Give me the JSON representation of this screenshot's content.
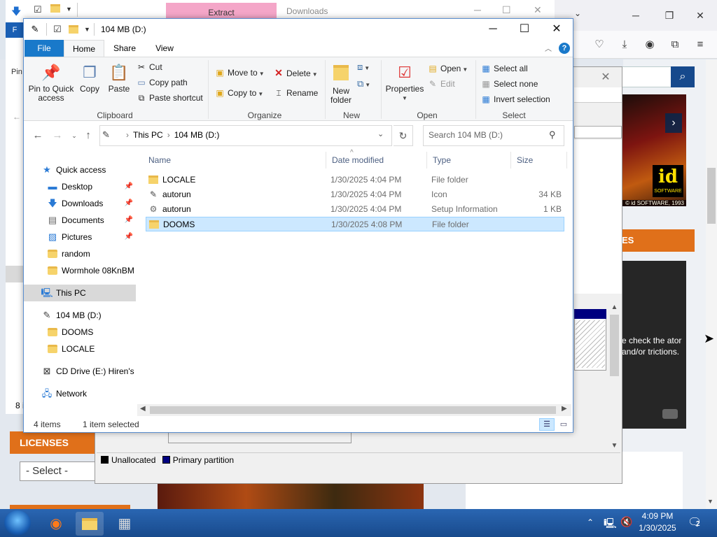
{
  "browser": {
    "controls": [
      "─",
      "❐",
      "✕"
    ],
    "toolbar_icons": [
      "pocket-icon",
      "download-icon",
      "account-icon",
      "extensions-icon",
      "menu-icon"
    ],
    "website": {
      "cover_next": "›",
      "id_logo": "id",
      "id_software": "SOFTWARE",
      "copyright": "© id SOFTWARE, 1993",
      "section_header": "ES",
      "video_text": "e check the ator and/or trictions.",
      "licenses_header": "LICENSES",
      "select_value": "- Select -"
    }
  },
  "disk_management": {
    "legend": [
      {
        "label": "Unallocated",
        "color": "#000000"
      },
      {
        "label": "Primary partition",
        "color": "#000080"
      }
    ]
  },
  "background_explorer": {
    "extract_tab": "Extract",
    "title": "Downloads",
    "file_tab": "F",
    "pin_label": "Pin",
    "items_count_partial": "8 i"
  },
  "explorer": {
    "title": "104 MB (D:)",
    "tabs": {
      "file": "File",
      "home": "Home",
      "share": "Share",
      "view": "View"
    },
    "ribbon": {
      "clipboard": {
        "label": "Clipboard",
        "pin": "Pin to Quick access",
        "copy": "Copy",
        "paste": "Paste",
        "cut": "Cut",
        "copy_path": "Copy path",
        "paste_shortcut": "Paste shortcut"
      },
      "organize": {
        "label": "Organize",
        "move_to": "Move to",
        "copy_to": "Copy to",
        "delete": "Delete",
        "rename": "Rename"
      },
      "new": {
        "label": "New",
        "new_folder": "New folder"
      },
      "open": {
        "label": "Open",
        "properties": "Properties",
        "open": "Open",
        "edit": "Edit"
      },
      "select": {
        "label": "Select",
        "select_all": "Select all",
        "select_none": "Select none",
        "invert": "Invert selection"
      }
    },
    "address": {
      "crumbs": [
        "This PC",
        "104 MB (D:)"
      ],
      "search_placeholder": "Search 104 MB (D:)"
    },
    "nav": {
      "quick_access": "Quick access",
      "desktop": "Desktop",
      "downloads": "Downloads",
      "documents": "Documents",
      "pictures": "Pictures",
      "random": "random",
      "wormhole": "Wormhole 08KnBM",
      "this_pc": "This PC",
      "drive_d": "104 MB (D:)",
      "dooms": "DOOMS",
      "locale": "LOCALE",
      "cd_drive": "CD Drive (E:) Hiren's I",
      "network": "Network"
    },
    "columns": {
      "name": "Name",
      "date": "Date modified",
      "type": "Type",
      "size": "Size"
    },
    "files": [
      {
        "name": "LOCALE",
        "date": "1/30/2025 4:04 PM",
        "type": "File folder",
        "size": "",
        "icon": "folder-icon"
      },
      {
        "name": "autorun",
        "date": "1/30/2025 4:04 PM",
        "type": "Icon",
        "size": "34 KB",
        "icon": "drive-icon"
      },
      {
        "name": "autorun",
        "date": "1/30/2025 4:04 PM",
        "type": "Setup Information",
        "size": "1 KB",
        "icon": "setup-file-icon"
      },
      {
        "name": "DOOMS",
        "date": "1/30/2025 4:08 PM",
        "type": "File folder",
        "size": "",
        "icon": "folder-icon"
      }
    ],
    "status": {
      "count": "4 items",
      "selected": "1 item selected"
    }
  },
  "taskbar": {
    "apps": [
      "start-icon",
      "firefox-icon",
      "file-explorer-icon",
      "installer-icon"
    ],
    "time": "4:09 PM",
    "date": "1/30/2025",
    "notifications": "2"
  }
}
